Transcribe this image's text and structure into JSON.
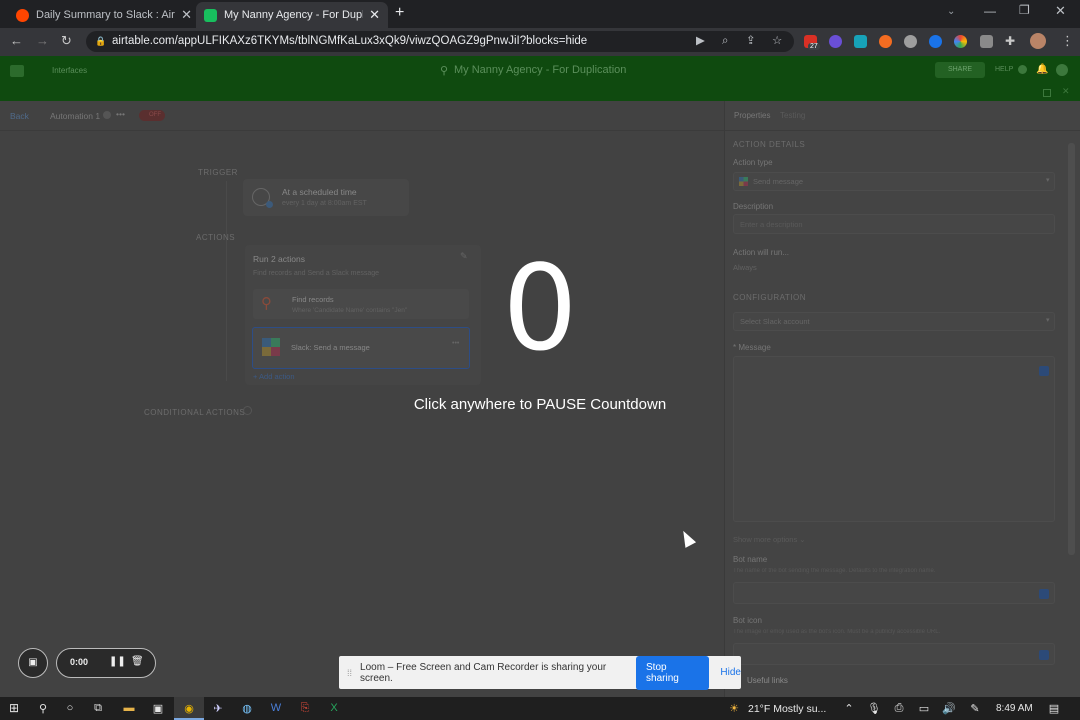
{
  "browser": {
    "tabs": [
      {
        "title": "Daily Summary to Slack : Airtable",
        "favicon_color": "#ff4500"
      },
      {
        "title": "My Nanny Agency - For Duplicatio",
        "favicon_color": "#18bf5e"
      }
    ],
    "new_tab_label": "+",
    "url": "airtable.com/appULFIKAXz6TKYMs/tblNGMfKaLux3xQk9/viwzQOAGZ9gPnwJiI?blocks=hide",
    "extension_badge": "27"
  },
  "airtable": {
    "interfaces_label": "Interfaces",
    "base_name": "My Nanny Agency - For Duplication",
    "share_label": "SHARE",
    "help_label": "HELP"
  },
  "automation": {
    "back_label": "Back",
    "name": "Automation 1",
    "more_label": "•••",
    "toggle_label": "OFF",
    "trigger_label": "TRIGGER",
    "trigger_title": "At a scheduled time",
    "trigger_sub": "every 1 day at 8:00am EST",
    "actions_label": "ACTIONS",
    "group_title": "Run 2 actions",
    "group_sub": "Find records and Send a Slack message",
    "action1_title": "Find records",
    "action1_sub": "Where 'Candidate Name' contains \"Jen\"",
    "action2_title": "Slack: Send a message",
    "action2_more": "•••",
    "add_action_label": "+ Add action",
    "conditional_label": "CONDITIONAL ACTIONS"
  },
  "panel": {
    "tab_properties": "Properties",
    "tab_testing": "Testing",
    "section_action_details": "ACTION DETAILS",
    "action_type_label": "Action type",
    "action_type_value": "Send message",
    "description_label": "Description",
    "description_placeholder": "Enter a description",
    "action_will_run_label": "Action will run...",
    "action_will_run_value": "Always",
    "section_configuration": "CONFIGURATION",
    "slack_account_placeholder": "Select Slack account",
    "message_label": "* Message",
    "show_more_label": "Show more options ⌄",
    "bot_name_label": "Bot name",
    "bot_name_help": "The name of the bot sending the message. Defaults to the integration name.",
    "bot_icon_label": "Bot icon",
    "bot_icon_help": "The image or emoji used as the bot's icon. Must be a publicly accessible URL.",
    "useful_links_label": "Useful links"
  },
  "countdown": {
    "number": "0",
    "message": "Click anywhere to PAUSE Countdown"
  },
  "recorder": {
    "timer": "0:00"
  },
  "loom": {
    "message": "Loom – Free Screen and Cam Recorder is sharing your screen.",
    "stop_label": "Stop sharing",
    "hide_label": "Hide"
  },
  "taskbar": {
    "weather": "21°F  Mostly su...",
    "time": "8:49 AM"
  }
}
